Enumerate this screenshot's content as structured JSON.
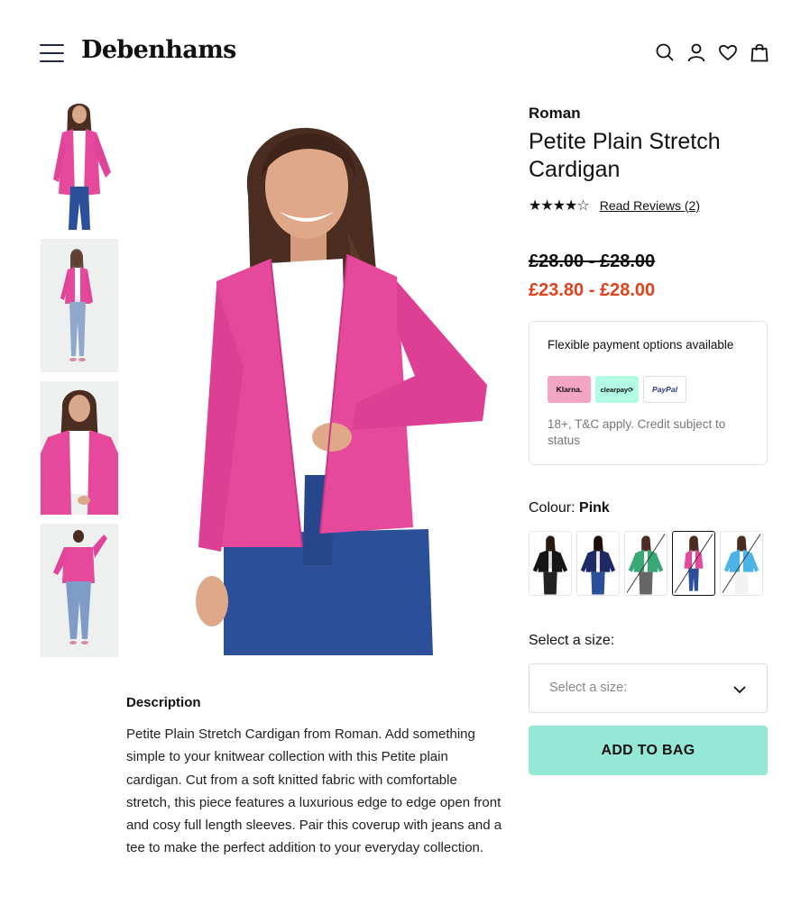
{
  "header": {
    "logo": "Debenhams",
    "icons": [
      "menu-icon",
      "search-icon",
      "account-icon",
      "heart-icon",
      "bag-icon"
    ]
  },
  "product": {
    "brand": "Roman",
    "title": "Petite Plain Stretch Cardigan",
    "rating": 4,
    "rating_max": 5,
    "stars_text": "★★★★☆",
    "reviews_link": "Read Reviews (2)",
    "old_price": "£28.00 - £28.00",
    "new_price": "£23.80 - £28.00"
  },
  "payment": {
    "title": "Flexible payment options available",
    "providers": [
      "Klarna.",
      "clearpay⟳",
      "PayPal"
    ],
    "note": "18+, T&C apply. Credit subject to status"
  },
  "colour": {
    "label": "Colour:",
    "selected": "Pink",
    "swatch_names": [
      "black",
      "navy",
      "green",
      "pink",
      "blue"
    ],
    "selected_index": 3
  },
  "size": {
    "label": "Select a size:",
    "placeholder": "Select a size:"
  },
  "add_to_bag": "ADD TO BAG",
  "description": {
    "title": "Description",
    "text": "Petite Plain Stretch Cardigan from Roman. Add something simple to your knitwear collection with this Petite plain cardigan. Cut from a soft knitted fabric with comfortable stretch, this piece features a luxurious edge to edge open front and cosy full length sleeves. Pair this coverup with jeans and a tee to make the perfect addition to your everyday collection."
  },
  "colors": {
    "accent_button": "#96e8d6",
    "sale_price": "#e0421b",
    "cardigan_pink": "#e6499c",
    "jeans_blue": "#2c4f9a"
  }
}
